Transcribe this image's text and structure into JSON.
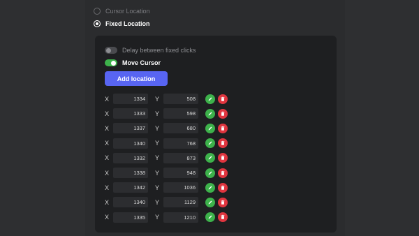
{
  "options": {
    "cursor_location": {
      "label": "Cursor Location",
      "selected": false
    },
    "fixed_location": {
      "label": "Fixed Location",
      "selected": true
    }
  },
  "panel": {
    "delay_toggle": {
      "label": "Delay between fixed clicks",
      "on": false
    },
    "move_cursor_toggle": {
      "label": "Move Cursor",
      "on": true
    },
    "add_button": "Add location",
    "x_label": "X",
    "y_label": "Y",
    "locations": [
      {
        "x": "1334",
        "y": "508"
      },
      {
        "x": "1333",
        "y": "598"
      },
      {
        "x": "1337",
        "y": "680"
      },
      {
        "x": "1340",
        "y": "768"
      },
      {
        "x": "1332",
        "y": "873"
      },
      {
        "x": "1338",
        "y": "948"
      },
      {
        "x": "1342",
        "y": "1036"
      },
      {
        "x": "1340",
        "y": "1129"
      },
      {
        "x": "1335",
        "y": "1210"
      }
    ]
  },
  "colors": {
    "accent": "#5865f2",
    "edit": "#3db24b",
    "delete": "#e0353f",
    "toggle_on": "#3db24b"
  }
}
